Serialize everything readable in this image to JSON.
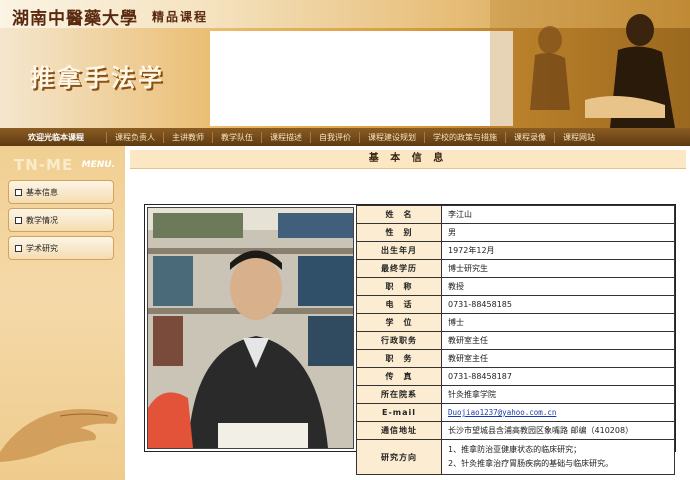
{
  "header": {
    "university": "湖南中醫藥大學",
    "subtitle": "精品课程",
    "course_title": "推拿手法学"
  },
  "nav": [
    "欢迎光临本课程",
    "课程负责人",
    "主讲教师",
    "教学队伍",
    "课程描述",
    "自我评价",
    "课程建设规划",
    "学校的政策与措施",
    "课程录像",
    "课程网站"
  ],
  "sidebar": {
    "watermark": "TN-ME",
    "menu_label": "MENU.",
    "items": [
      "基本信息",
      "教学情况",
      "学术研究"
    ]
  },
  "main": {
    "heading": "基 本 信 息"
  },
  "profile": {
    "rows": [
      {
        "k": "姓　名",
        "v": "李江山"
      },
      {
        "k": "性　别",
        "v": "男"
      },
      {
        "k": "出生年月",
        "v": "1972年12月"
      },
      {
        "k": "最终学历",
        "v": "博士研究生"
      },
      {
        "k": "职　称",
        "v": "教授"
      },
      {
        "k": "电　话",
        "v": "0731-88458185"
      },
      {
        "k": "学　位",
        "v": "博士"
      },
      {
        "k": "行政职务",
        "v": "教研室主任"
      },
      {
        "k": "职　务",
        "v": "教研室主任"
      },
      {
        "k": "传　真",
        "v": "0731-88458187"
      },
      {
        "k": "所在院系",
        "v": "针灸推拿学院"
      }
    ],
    "email_label": "E-mail",
    "email": "Duojiao1237@yahoo.com.cn",
    "address_label": "通信地址",
    "address": "长沙市望城县含浦高教园区象嘴路 邮编（410208）",
    "research_label": "研究方向",
    "research": [
      "1、推拿防治亚健康状态的临床研究；",
      "2、针灸推拿治疗胃肠疾病的基础与临床研究。"
    ]
  }
}
